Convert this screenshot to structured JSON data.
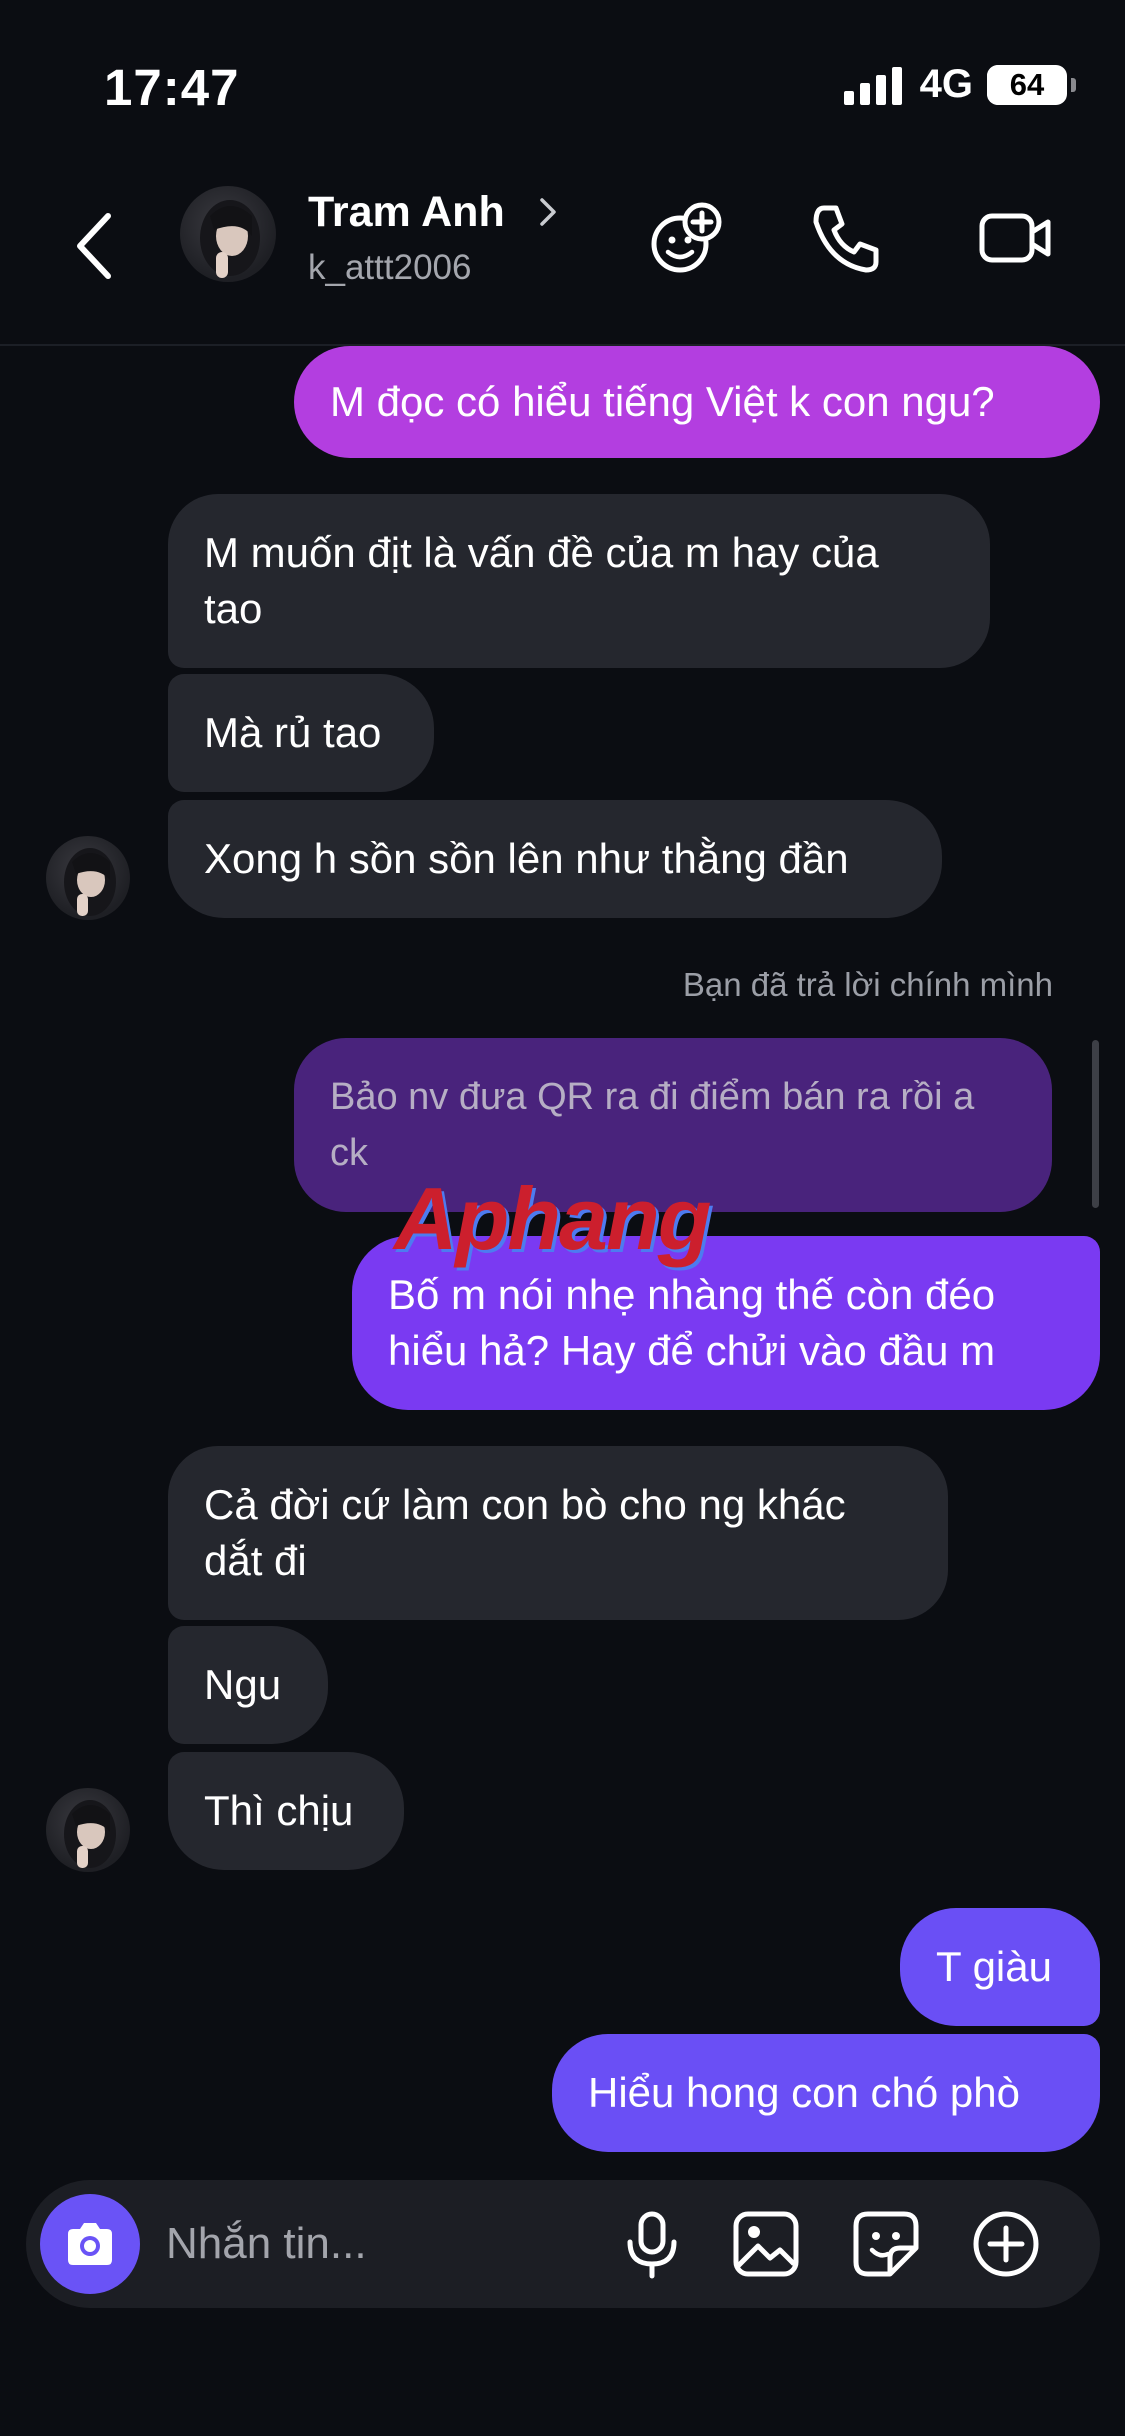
{
  "status_bar": {
    "time": "17:47",
    "network": "4G",
    "battery": "64",
    "battery_level": 0.64
  },
  "header": {
    "name": "Tram Anh",
    "username": "k_attt2006",
    "icons": [
      "back-icon",
      "chevron-right-icon",
      "effects-icon",
      "phone-icon",
      "video-icon"
    ]
  },
  "messages": [
    {
      "side": "out",
      "text": "M đọc có hiểu tiếng Việt k con ngu?"
    },
    {
      "side": "in",
      "lines": [
        "M muốn địt là vấn đề của m hay của",
        "tao"
      ]
    },
    {
      "side": "in",
      "text": "Mà rủ tao"
    },
    {
      "side": "in",
      "text": "Xong h sồn sồn lên như thằng đần"
    },
    {
      "side": "out",
      "reply_note": "Bạn đã trả lời chính mình",
      "quoted_lines": [
        "Bảo nv đưa QR ra đi điểm bán ra rồi a",
        "ck"
      ]
    },
    {
      "side": "out",
      "lines": [
        "Bố m nói nhẹ nhàng thế còn đéo",
        "hiểu hả? Hay để chửi vào đầu m"
      ]
    },
    {
      "side": "in",
      "lines": [
        "Cả đời cứ làm con bò cho ng khác",
        "dắt đi"
      ]
    },
    {
      "side": "in",
      "text": "Ngu"
    },
    {
      "side": "in",
      "text": "Thì chịu"
    },
    {
      "side": "out",
      "text": "T giàu"
    },
    {
      "side": "out",
      "text": "Hiểu hong con chó phò"
    }
  ],
  "watermark": "Aphang",
  "composer": {
    "placeholder": "Nhắn tin...",
    "icons": [
      "camera-icon",
      "microphone-icon",
      "gallery-icon",
      "sticker-icon",
      "add-icon"
    ]
  },
  "colors": {
    "background": "#0b0d12",
    "incoming_bubble": "#25272e",
    "outgoing_magenta": "#b33ee0",
    "outgoing_violet": "#7a3af2",
    "outgoing_indigo": "#6a4ff5",
    "camera_button": "#6a53f6"
  }
}
